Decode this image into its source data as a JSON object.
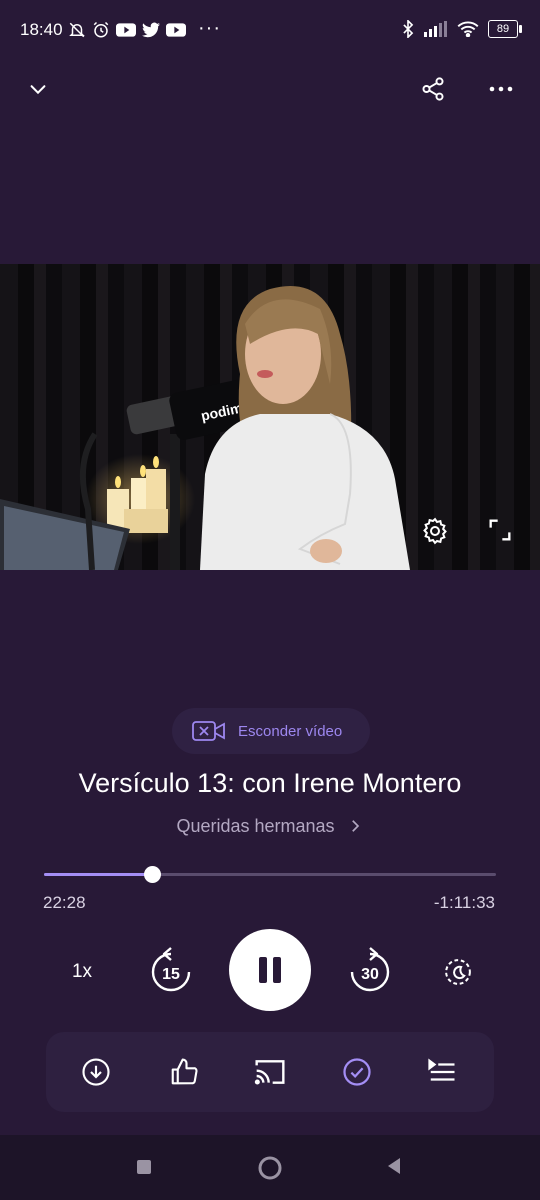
{
  "status_bar": {
    "time": "18:40",
    "more": "···",
    "battery": "89",
    "icons_left": [
      "bell-off-icon",
      "alarm-icon",
      "youtube-icon",
      "twitter-icon",
      "youtube-icon"
    ],
    "icons_right": [
      "bluetooth-icon",
      "signal-icon",
      "wifi-icon",
      "battery-icon"
    ]
  },
  "header": {
    "collapse_icon": "chevron-down-icon",
    "share_icon": "share-icon",
    "menu_icon": "more-horizontal-icon"
  },
  "video": {
    "settings_icon": "gear-icon",
    "fullscreen_icon": "fullscreen-icon"
  },
  "hide_video": {
    "label": "Esconder vídeo",
    "icon": "video-off-icon"
  },
  "episode": {
    "title": "Versículo 13: con Irene Montero",
    "show": "Queridas hermanas"
  },
  "progress": {
    "elapsed": "22:28",
    "remaining": "-1:11:33",
    "fraction": 0.24
  },
  "controls": {
    "speed": "1x",
    "rewind_seconds": "15",
    "forward_seconds": "30",
    "play_state": "pause",
    "sleep_icon": "sleep-timer-icon"
  },
  "bottom_actions": [
    "download-icon",
    "thumbs-up-icon",
    "cast-icon",
    "check-icon",
    "queue-icon"
  ],
  "colors": {
    "background": "#281937",
    "accent": "#a48ef5",
    "button_bg": "#2e2040"
  }
}
